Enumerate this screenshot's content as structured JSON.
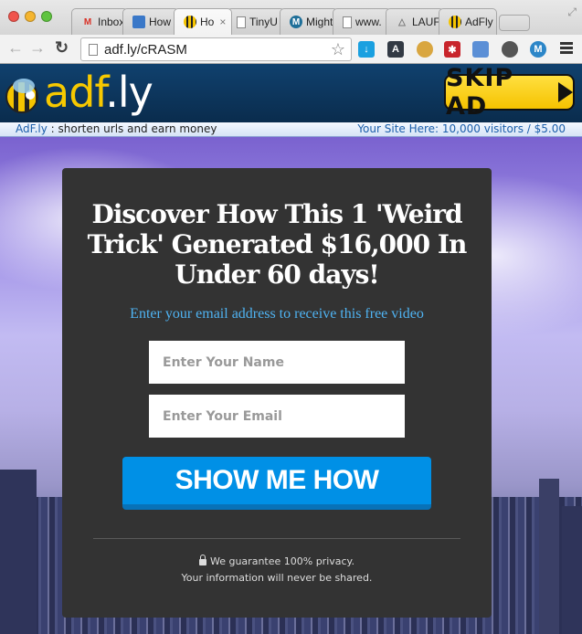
{
  "browser": {
    "tabs": [
      {
        "label": "Inbox",
        "icon": "gmail-icon",
        "active": false
      },
      {
        "label": "How",
        "icon": "window-icon",
        "active": false
      },
      {
        "label": "Ho",
        "icon": "bee-icon",
        "active": true
      },
      {
        "label": "TinyU",
        "icon": "page-icon",
        "active": false
      },
      {
        "label": "Might",
        "icon": "mightytext-icon",
        "active": false
      },
      {
        "label": "www.",
        "icon": "page-icon",
        "active": false
      },
      {
        "label": "LAUF",
        "icon": "triangle-icon",
        "active": false
      },
      {
        "label": "AdFly",
        "icon": "bee-icon",
        "active": false
      }
    ],
    "close_glyph": "×",
    "url": "adf.ly/cRASM",
    "extensions": [
      "download-icon",
      "translate-icon",
      "coins-icon",
      "lastpass-icon",
      "window-tool-icon",
      "evernote-icon",
      "mightytext-icon"
    ],
    "colors": {
      "download": "#1aa0e0",
      "translate": "#333a44",
      "coins": "#d9a640",
      "lastpass": "#c8242b",
      "window_tool": "#5b8fd6",
      "evernote": "#555555",
      "mightytext": "#2c86c8"
    }
  },
  "adbar": {
    "logo_part1": "adf",
    "logo_part2": ".ly",
    "skip_label": "SKIP AD",
    "site_link": "AdF.ly",
    "tagline": " : shorten urls and earn money",
    "promo": "Your Site Here: 10,000 visitors / $5.00"
  },
  "offer": {
    "headline": "Discover How This 1 'Weird Trick' Generated $16,000 In Under 60 days!",
    "subheadline": "Enter your email address to receive this free video",
    "name_placeholder": "Enter Your Name",
    "email_placeholder": "Enter Your Email",
    "name_value": "",
    "email_value": "",
    "cta_label": "SHOW ME HOW",
    "privacy_line1": "We guarantee 100% privacy.",
    "privacy_line2": "Your information will never be shared.",
    "colors": {
      "cta": "#0090e6",
      "subheadline": "#4fb3f2",
      "panel": "#333333"
    }
  }
}
